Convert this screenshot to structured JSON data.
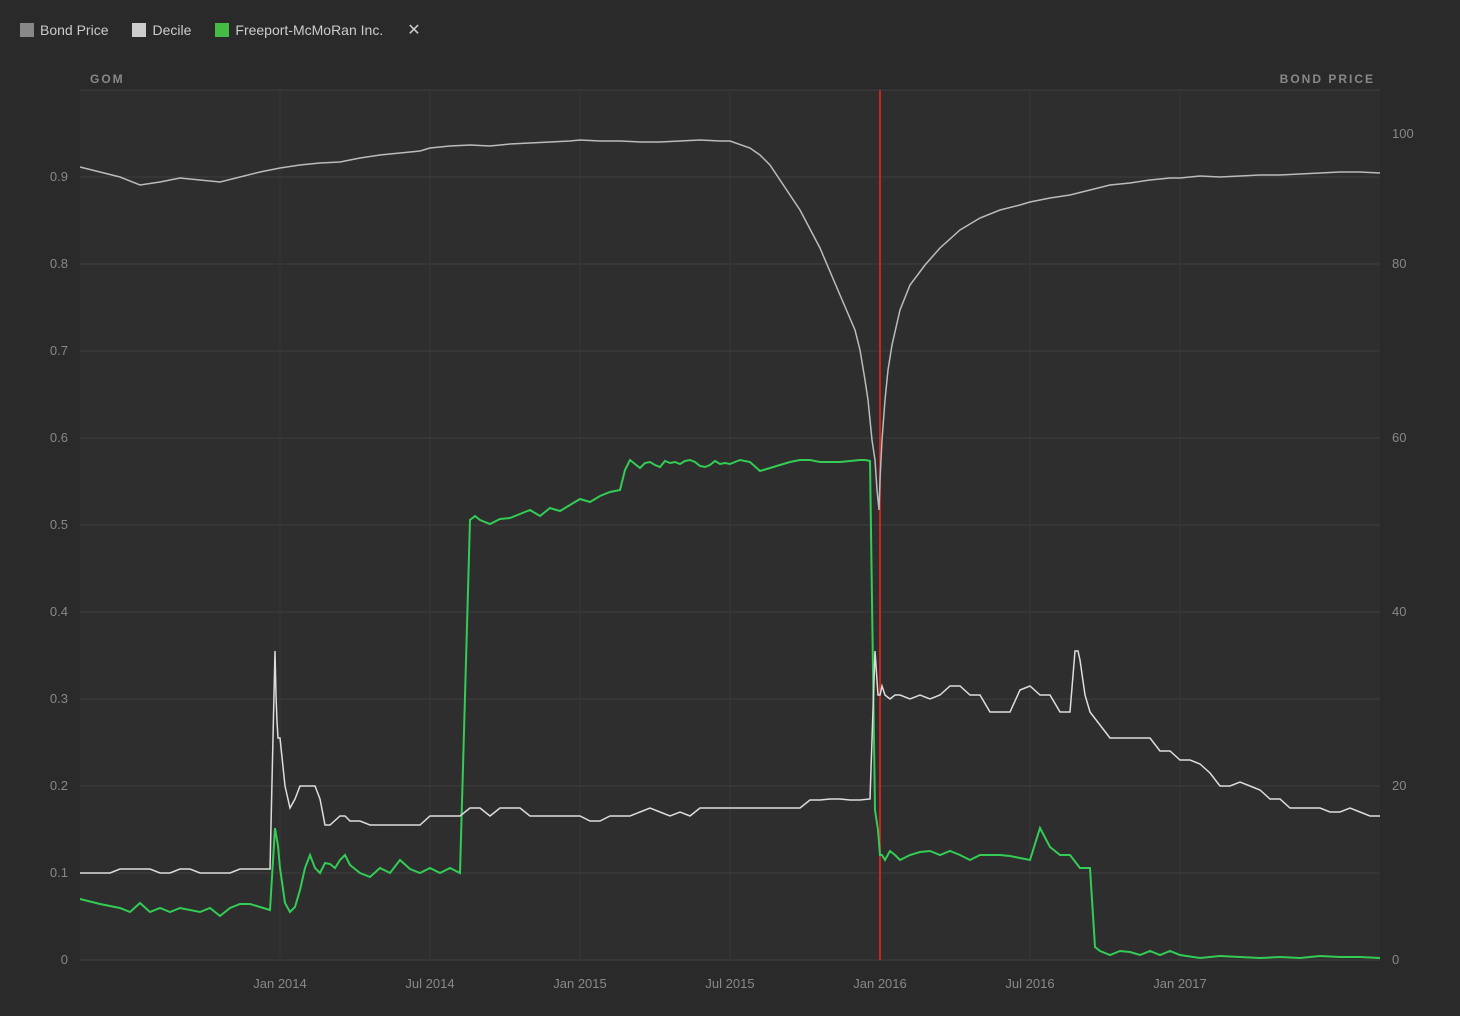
{
  "legend": {
    "items": [
      {
        "label": "Bond Price",
        "color": "#888888",
        "shape": "square"
      },
      {
        "label": "Decile",
        "color": "#cccccc",
        "shape": "square"
      },
      {
        "label": "Freeport-McMoRan Inc.",
        "color": "#44bb44",
        "shape": "square"
      },
      {
        "label": "close",
        "color": "#cccccc",
        "shape": "x"
      }
    ]
  },
  "axis": {
    "left_label": "GOM",
    "right_label": "BOND PRICE",
    "y_left": [
      "0.9",
      "0.8",
      "0.7",
      "0.6",
      "0.5",
      "0.4",
      "0.3",
      "0.2",
      "0.1",
      "0"
    ],
    "y_right": [
      "100",
      "80",
      "60",
      "40",
      "20",
      "0"
    ],
    "x_labels": [
      "Jan 2014",
      "Jul 2014",
      "Jan 2015",
      "Jul 2015",
      "Jan 2016",
      "Jul 2016",
      "Jan 2017"
    ]
  },
  "colors": {
    "background": "#2a2a2a",
    "grid": "#3a3a3a",
    "decile_line": "#aaaaaa",
    "bond_price_line": "#888888",
    "freeport_line": "#33cc55",
    "red_line": "#cc2222",
    "axis_text": "#888888"
  }
}
